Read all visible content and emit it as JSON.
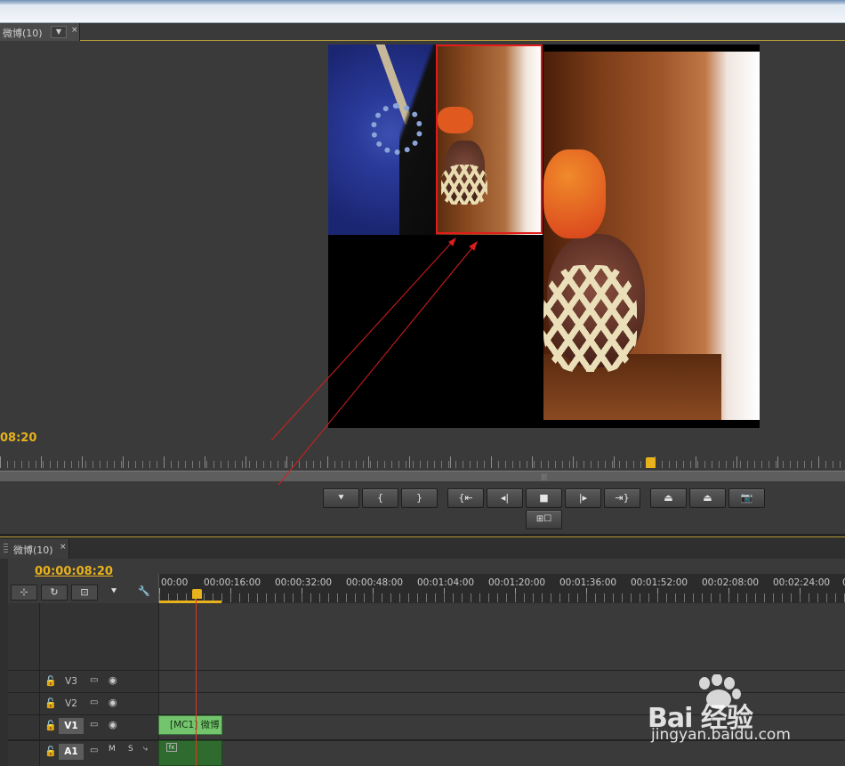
{
  "program_monitor": {
    "tab_title": "微博(10)",
    "tab_menu_icon": "chevron-down-icon",
    "close_glyph": "×",
    "timecode": "08:20",
    "transport": [
      {
        "name": "add-marker-button",
        "glyph": "⯆"
      },
      {
        "name": "mark-in-button",
        "glyph": "{"
      },
      {
        "name": "mark-out-button",
        "glyph": "}"
      },
      {
        "name": "go-to-in-button",
        "glyph": "{⇤"
      },
      {
        "name": "step-back-button",
        "glyph": "◂|"
      },
      {
        "name": "stop-button",
        "glyph": "■"
      },
      {
        "name": "step-forward-button",
        "glyph": "|▸"
      },
      {
        "name": "go-to-out-button",
        "glyph": "⇥}"
      },
      {
        "name": "lift-button",
        "glyph": "⏏"
      },
      {
        "name": "extract-button",
        "glyph": "⏏"
      },
      {
        "name": "export-frame-button",
        "glyph": "📷"
      }
    ],
    "multicam_glyph": "⊞☐"
  },
  "timeline": {
    "tab_title": "微博(10)",
    "close_glyph": "×",
    "timecode": "00:00:08:20",
    "tools": [
      "⊹",
      "↻",
      "⊡",
      "⯆",
      "🔧"
    ],
    "ruler_labels": [
      "00:00",
      "00:00:16:00",
      "00:00:32:00",
      "00:00:48:00",
      "00:01:04:00",
      "00:01:20:00",
      "00:01:36:00",
      "00:01:52:00",
      "00:02:08:00",
      "00:02:24:00",
      "0"
    ],
    "tracks": [
      {
        "label": "V3",
        "lock": "🔓",
        "toggle": "▭",
        "eye": "◉"
      },
      {
        "label": "V2",
        "lock": "🔓",
        "toggle": "▭",
        "eye": "◉"
      },
      {
        "label": "V1",
        "lock": "🔓",
        "toggle": "▭",
        "eye": "◉"
      },
      {
        "label": "A1",
        "lock": "🔓",
        "toggle": "▭",
        "m": "M",
        "s": "S",
        "extra": "⤷"
      }
    ],
    "clip_v1": "[MC1] 微博",
    "clip_a1_fx": "fx"
  },
  "watermark": {
    "logo_text": "Bai 经验",
    "url": "jingyan.baidu.com"
  },
  "colors": {
    "accent": "#e8b21c",
    "playhead": "#d9381e",
    "selection_frame": "#e21b1b",
    "clip_video": "#74c46e",
    "clip_audio": "#2f6b2f"
  }
}
